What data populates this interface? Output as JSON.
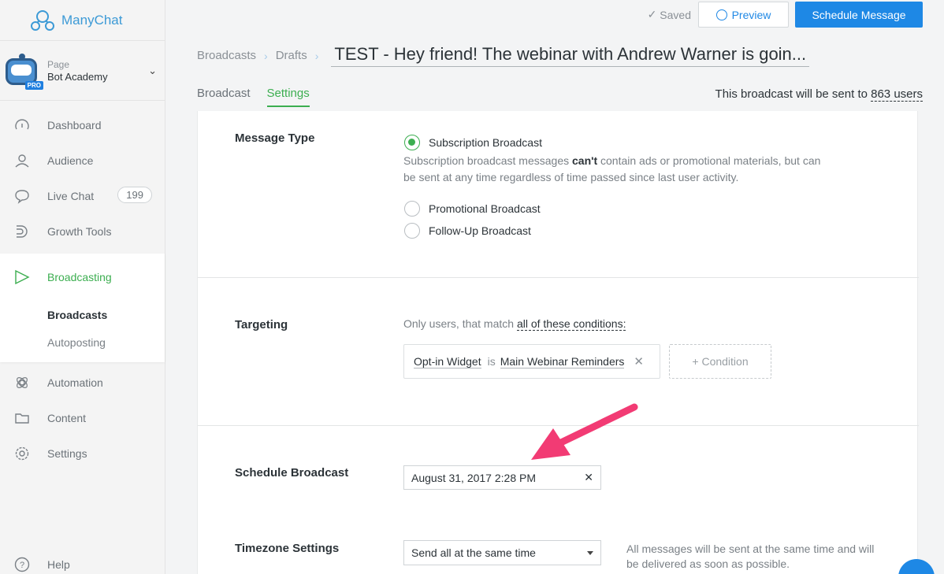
{
  "app": {
    "name": "ManyChat"
  },
  "page": {
    "label": "Page",
    "name": "Bot Academy",
    "pro_badge": "PRO"
  },
  "sidebar": {
    "items": [
      {
        "label": "Dashboard",
        "icon": "dashboard-icon"
      },
      {
        "label": "Audience",
        "icon": "user-icon"
      },
      {
        "label": "Live Chat",
        "icon": "chat-icon",
        "badge": "199"
      },
      {
        "label": "Growth Tools",
        "icon": "growth-tools-icon"
      }
    ],
    "active": {
      "label": "Broadcasting",
      "icon": "send-icon"
    },
    "subitems": [
      {
        "label": "Broadcasts",
        "current": true
      },
      {
        "label": "Autoposting",
        "current": false
      }
    ],
    "items_after": [
      {
        "label": "Automation",
        "icon": "automation-icon"
      },
      {
        "label": "Content",
        "icon": "folder-icon"
      },
      {
        "label": "Settings",
        "icon": "gear-icon"
      }
    ],
    "help": "Help"
  },
  "topbar": {
    "saved": "Saved",
    "preview": "Preview",
    "schedule": "Schedule Message"
  },
  "breadcrumb": {
    "items": [
      "Broadcasts",
      "Drafts"
    ],
    "title": "TEST - Hey friend! The webinar with Andrew Warner is goin..."
  },
  "tabs": [
    {
      "label": "Broadcast",
      "active": false
    },
    {
      "label": "Settings",
      "active": true
    }
  ],
  "send_info": {
    "prefix": "This broadcast will be sent to ",
    "users": "863 users"
  },
  "message_type": {
    "label": "Message Type",
    "options": [
      {
        "label": "Subscription Broadcast",
        "selected": true
      },
      {
        "label": "Promotional Broadcast",
        "selected": false
      },
      {
        "label": "Follow-Up Broadcast",
        "selected": false
      }
    ],
    "desc_before": "Subscription broadcast messages ",
    "desc_bold": "can't",
    "desc_after": " contain ads or promotional materials, but can be sent at any time regardless of time passed since last user activity."
  },
  "targeting": {
    "label": "Targeting",
    "text_prefix": "Only users, that match ",
    "text_conditions": "all of these conditions:",
    "condition": {
      "field": "Opt-in Widget",
      "operator": "is",
      "value": "Main Webinar Reminders"
    },
    "add_condition": "+ Condition"
  },
  "schedule": {
    "label": "Schedule Broadcast",
    "value": "August 31, 2017 2:28 PM"
  },
  "timezone": {
    "label": "Timezone Settings",
    "selected": "Send all at the same time",
    "note": "All messages will be sent at the same time and will be delivered as soon as possible."
  },
  "colors": {
    "accent_green": "#3cae50",
    "primary_blue": "#1e88e5",
    "arrow_pink": "#f23b74"
  }
}
